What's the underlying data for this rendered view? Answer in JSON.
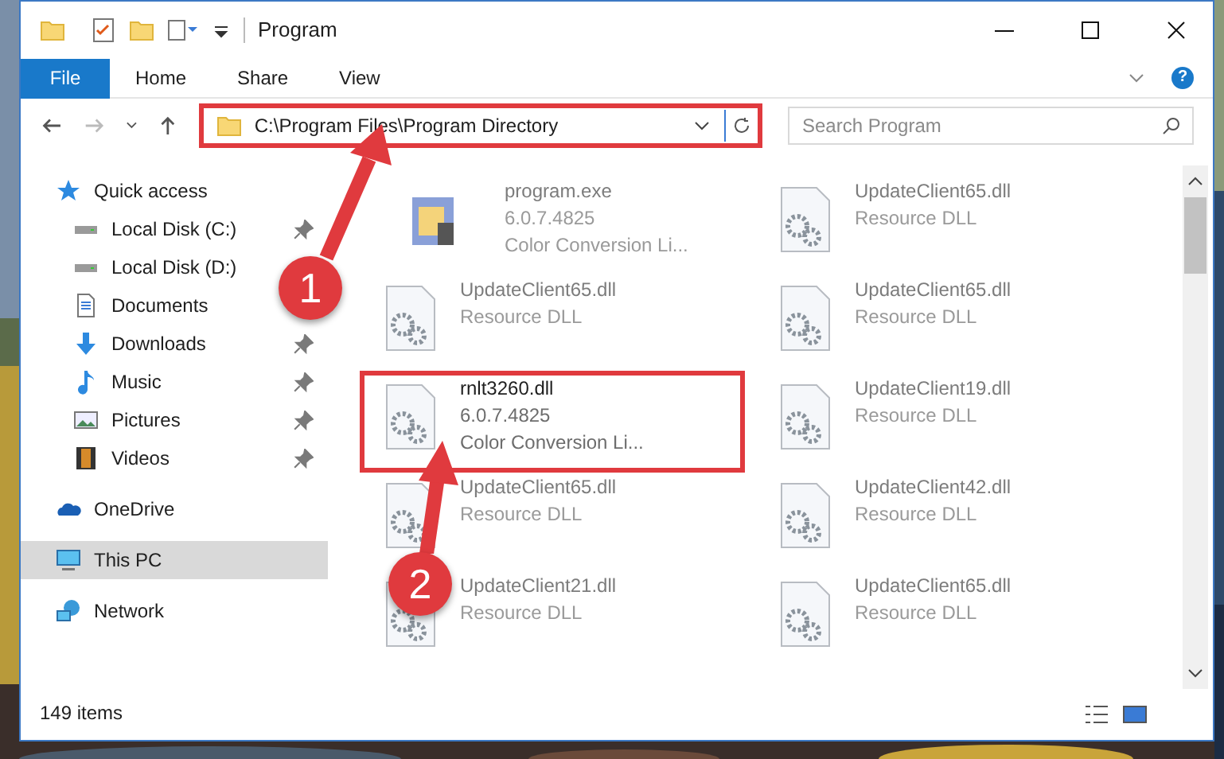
{
  "window": {
    "title": "Program"
  },
  "ribbon": {
    "tabs": [
      {
        "label": "File",
        "selected": true
      },
      {
        "label": "Home",
        "selected": false
      },
      {
        "label": "Share",
        "selected": false
      },
      {
        "label": "View",
        "selected": false
      }
    ],
    "help": "?"
  },
  "address": {
    "path": "C:\\Program Files\\Program Directory",
    "highlighted": true
  },
  "search": {
    "placeholder": "Search Program"
  },
  "sidebar": {
    "items": [
      {
        "label": "Quick access",
        "kind": "star",
        "selected": false,
        "children": [
          {
            "label": "Local Disk (C:)",
            "kind": "drive",
            "pinned": true,
            "selected": false
          },
          {
            "label": "Local Disk (D:)",
            "kind": "drive",
            "selected": false
          },
          {
            "label": "Documents",
            "kind": "document",
            "selected": false
          },
          {
            "label": "Downloads",
            "kind": "download",
            "pinned": true,
            "selected": false
          },
          {
            "label": "Music",
            "kind": "music",
            "pinned": true,
            "selected": false
          },
          {
            "label": "Pictures",
            "kind": "pictures",
            "pinned": true,
            "selected": false
          },
          {
            "label": "Videos",
            "kind": "videos",
            "pinned": true,
            "selected": false
          }
        ]
      },
      {
        "label": "OneDrive",
        "kind": "cloud",
        "selected": false
      },
      {
        "label": "This PC",
        "kind": "pc",
        "selected": true
      },
      {
        "label": "Network",
        "kind": "network",
        "selected": false
      }
    ]
  },
  "files": [
    {
      "name": "program.exe",
      "details": [
        "6.0.7.4825",
        "Color Conversion Li..."
      ],
      "kind": "exe",
      "highlighted": false
    },
    {
      "name": "UpdateClient65.dll",
      "details": [
        "Resource DLL"
      ],
      "kind": "dll",
      "highlighted": false
    },
    {
      "name": "UpdateClient65.dll",
      "details": [
        "Resource DLL"
      ],
      "kind": "dll",
      "highlighted": false
    },
    {
      "name": "UpdateClient65.dll",
      "details": [
        "Resource DLL"
      ],
      "kind": "dll",
      "highlighted": false
    },
    {
      "name": "rnlt3260.dll",
      "details": [
        "6.0.7.4825",
        "Color Conversion Li..."
      ],
      "kind": "dll",
      "highlighted": true
    },
    {
      "name": "UpdateClient19.dll",
      "details": [
        "Resource DLL"
      ],
      "kind": "dll",
      "highlighted": false
    },
    {
      "name": "UpdateClient65.dll",
      "details": [
        "Resource DLL"
      ],
      "kind": "dll",
      "highlighted": false
    },
    {
      "name": "UpdateClient42.dll",
      "details": [
        "Resource DLL"
      ],
      "kind": "dll",
      "highlighted": false
    },
    {
      "name": "UpdateClient21.dll",
      "details": [
        "Resource DLL"
      ],
      "kind": "dll",
      "highlighted": false
    },
    {
      "name": "UpdateClient65.dll",
      "details": [
        "Resource DLL"
      ],
      "kind": "dll",
      "highlighted": false
    }
  ],
  "status_bar": {
    "items": "149 items"
  },
  "annotations": [
    {
      "number": "1"
    },
    {
      "number": "2"
    }
  ]
}
